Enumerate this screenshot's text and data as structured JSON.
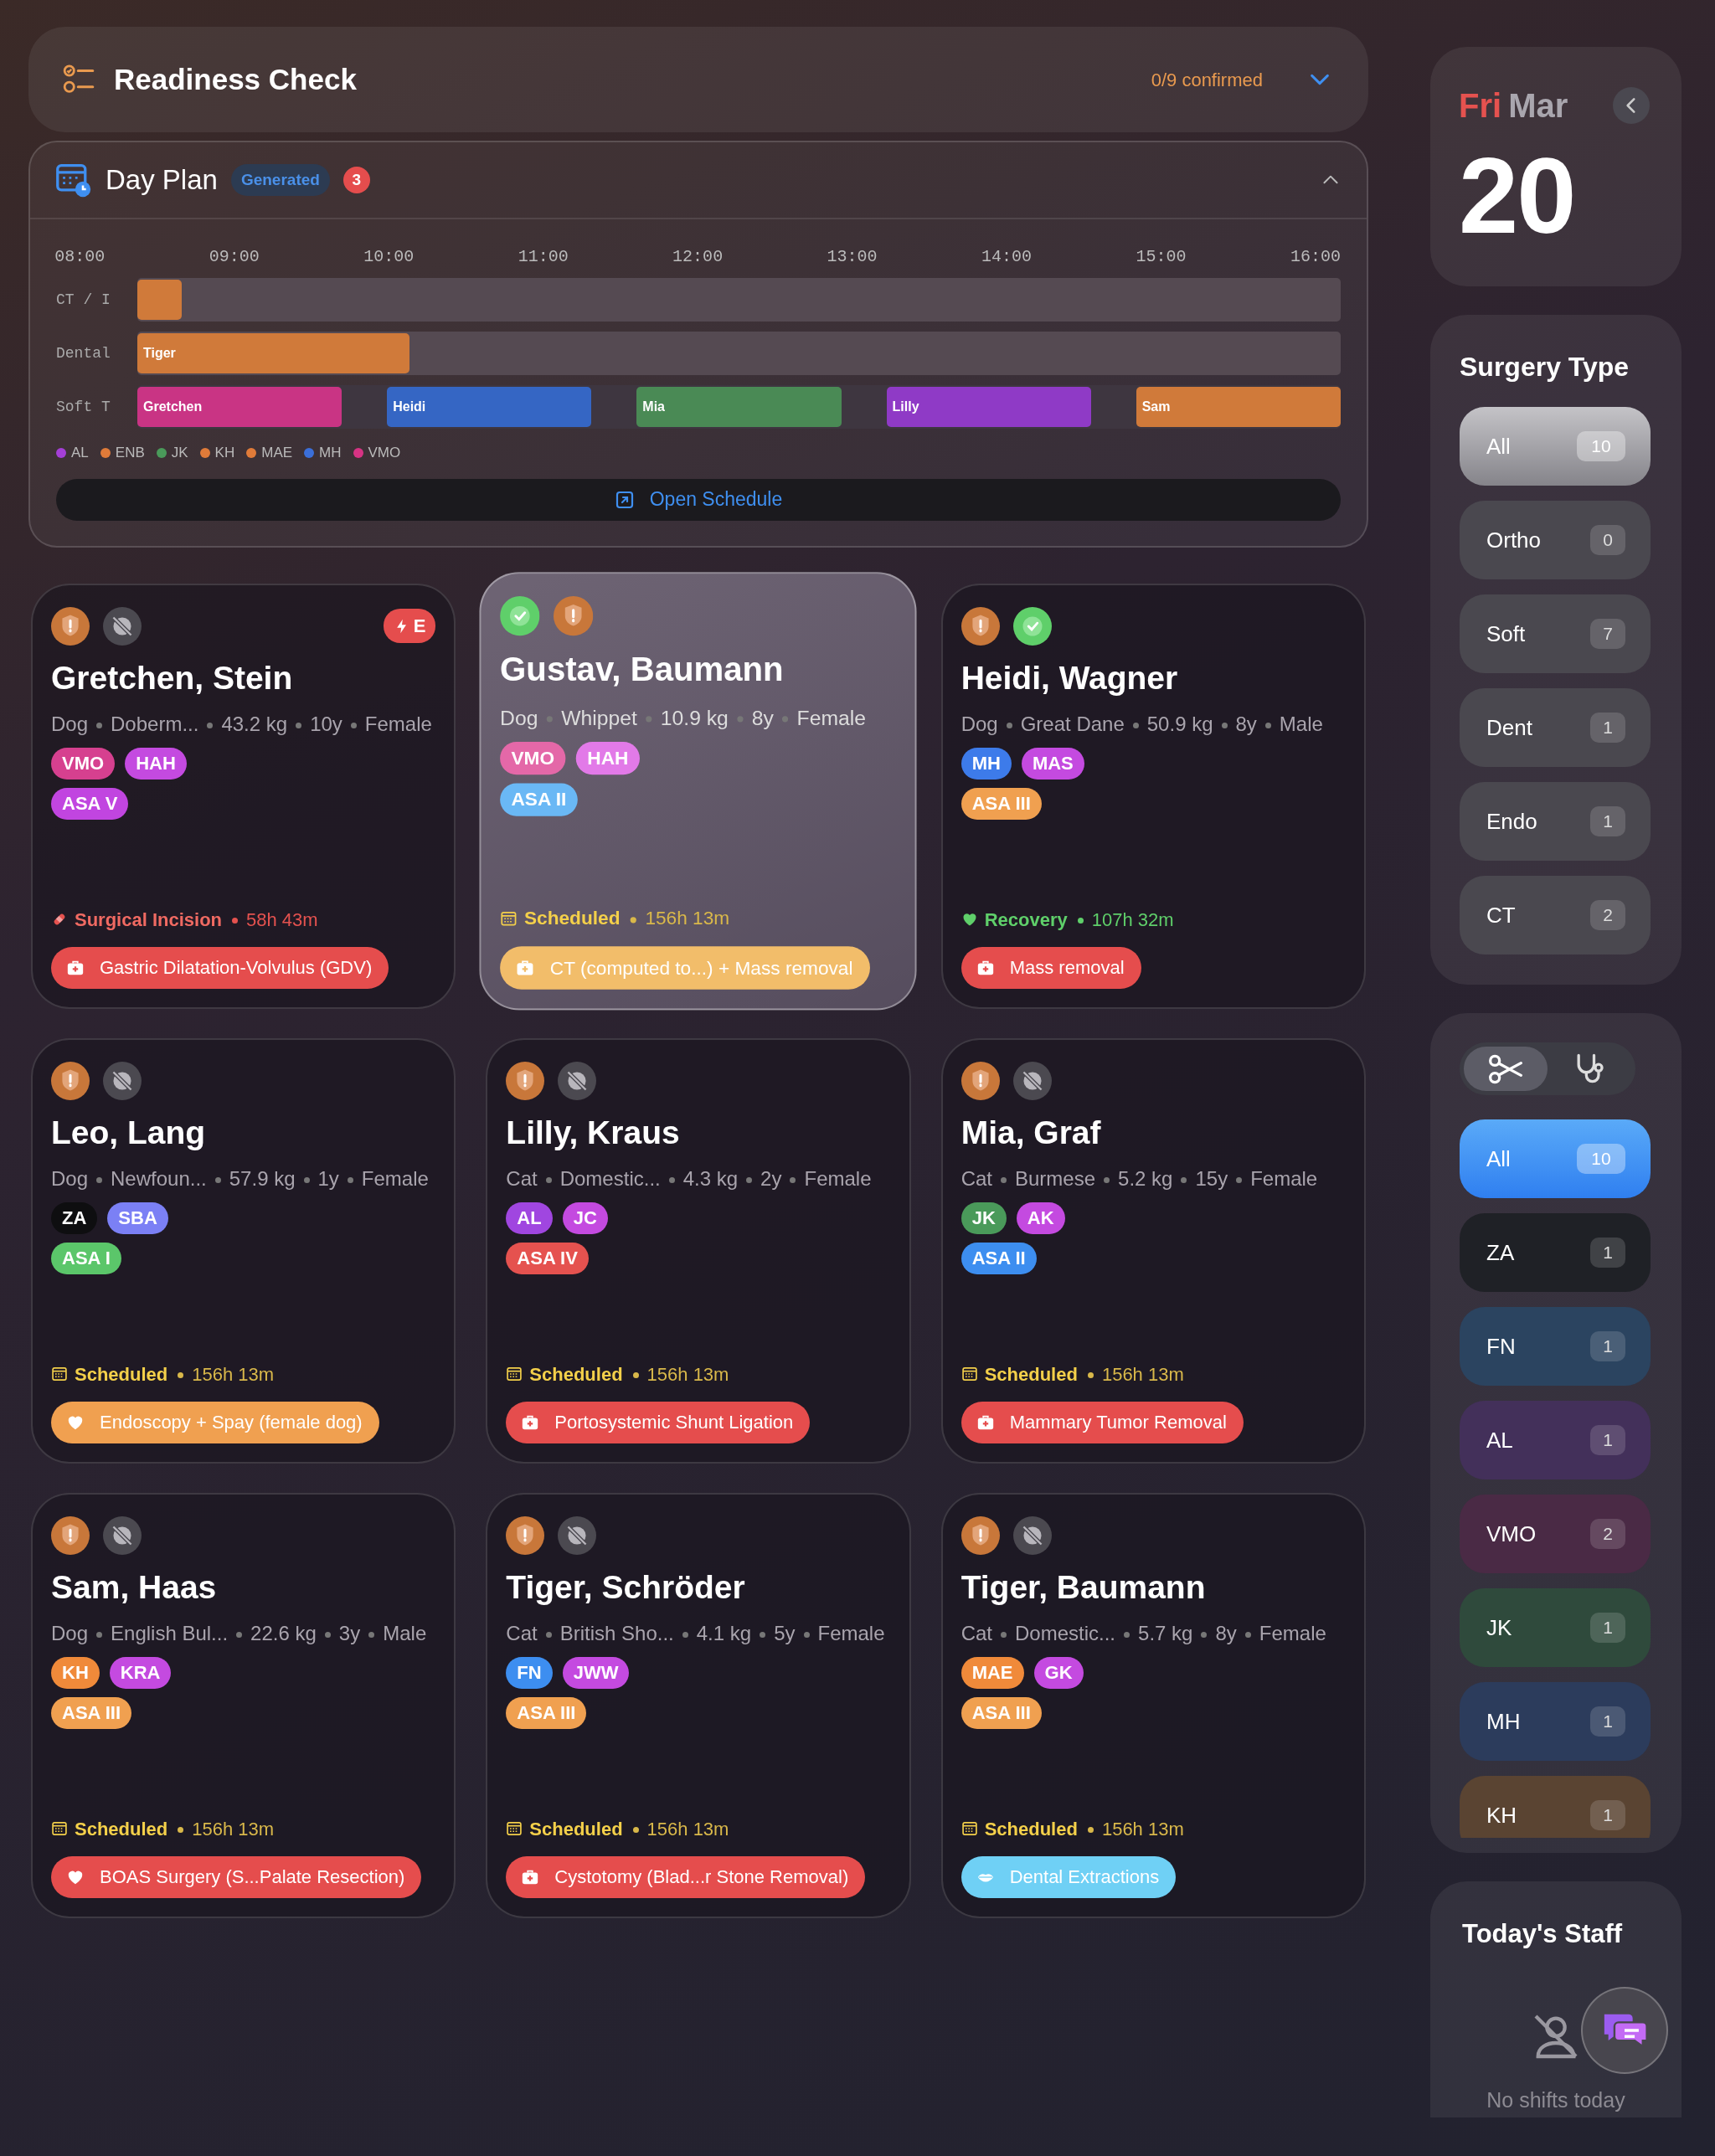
{
  "readiness": {
    "title": "Readiness Check",
    "summary": "0/9 confirmed",
    "expanded": false
  },
  "day_plan": {
    "title": "Day Plan",
    "badge": "Generated",
    "count": "3",
    "expanded": true,
    "ticks": [
      "08:00",
      "09:00",
      "10:00",
      "11:00",
      "12:00",
      "13:00",
      "14:00",
      "15:00",
      "16:00"
    ],
    "lanes": [
      {
        "label": "CT / I",
        "bars": [
          {
            "level": 0.037,
            "color": "#d07a3a"
          }
        ]
      },
      {
        "label": "Dental",
        "bars": [
          {
            "label": "Tiger",
            "level": 0.226,
            "color": "#d07a3a"
          }
        ]
      },
      {
        "label": "Soft T",
        "bars": [
          {
            "label": "Gretchen",
            "color": "#c93484"
          },
          {
            "label": "Heidi",
            "color": "#3566c4"
          },
          {
            "label": "Mia",
            "color": "#4a8a55"
          },
          {
            "label": "Lilly",
            "color": "#8f3ac6"
          },
          {
            "label": "Sam",
            "color": "#d07a3a"
          }
        ]
      }
    ],
    "legend": [
      {
        "label": "AL",
        "color": "#a43fd6"
      },
      {
        "label": "ENB",
        "color": "#e07b39"
      },
      {
        "label": "JK",
        "color": "#4a9a5a"
      },
      {
        "label": "KH",
        "color": "#e07b39"
      },
      {
        "label": "MAE",
        "color": "#e07b39"
      },
      {
        "label": "MH",
        "color": "#3b6fd9"
      },
      {
        "label": "VMO",
        "color": "#d63384"
      }
    ],
    "action": "Open Schedule"
  },
  "patients": [
    {
      "name": "Gretchen, Stein",
      "selected": false,
      "flags": [
        {
          "kind": "alert"
        },
        {
          "kind": "blocked"
        }
      ],
      "emergency": "E",
      "details": [
        "Dog",
        "Doberm...",
        "43.2 kg",
        "10y",
        "Female"
      ],
      "staff": [
        {
          "label": "VMO",
          "color": "#d6408f"
        },
        {
          "label": "HAH",
          "color": "#c44ae0"
        }
      ],
      "asa": {
        "label": "ASA V",
        "color": "#c145e0"
      },
      "status": {
        "kind": "incision",
        "label": "Surgical Incision",
        "time": "58h 43m"
      },
      "procedure": {
        "kind": "medkit",
        "label": "Gastric Dilatation-Volvulus (GDV)",
        "color": "#e54d4d"
      }
    },
    {
      "name": "Gustav, Baumann",
      "selected": true,
      "flags": [
        {
          "kind": "check"
        },
        {
          "kind": "alert"
        }
      ],
      "details": [
        "Dog",
        "Whippet",
        "10.9 kg",
        "8y",
        "Female"
      ],
      "staff": [
        {
          "label": "VMO",
          "color": "#e468a8"
        },
        {
          "label": "HAH",
          "color": "#e27ae8"
        }
      ],
      "asa": {
        "label": "ASA II",
        "color": "#6ab8f5"
      },
      "status": {
        "kind": "scheduled",
        "label": "Scheduled",
        "time": "156h 13m"
      },
      "procedure": {
        "kind": "medkit",
        "label": "CT (computed to...) + Mass removal",
        "color": "#f2bd6a"
      }
    },
    {
      "name": "Heidi, Wagner",
      "selected": false,
      "flags": [
        {
          "kind": "alert"
        },
        {
          "kind": "check"
        }
      ],
      "details": [
        "Dog",
        "Great Dane",
        "50.9 kg",
        "8y",
        "Male"
      ],
      "staff": [
        {
          "label": "MH",
          "color": "#3d7bea"
        },
        {
          "label": "MAS",
          "color": "#c44ae0"
        }
      ],
      "asa": {
        "label": "ASA III",
        "color": "#f0a050"
      },
      "status": {
        "kind": "recovery",
        "label": "Recovery",
        "time": "107h 32m"
      },
      "procedure": {
        "kind": "medkit",
        "label": "Mass removal",
        "color": "#e54d4d"
      }
    },
    {
      "name": "Leo, Lang",
      "selected": false,
      "flags": [
        {
          "kind": "alert"
        },
        {
          "kind": "blocked"
        }
      ],
      "details": [
        "Dog",
        "Newfoun...",
        "57.9 kg",
        "1y",
        "Female"
      ],
      "staff": [
        {
          "label": "ZA",
          "color": "#0e0e10"
        },
        {
          "label": "SBA",
          "color": "#7b80f5"
        }
      ],
      "asa": {
        "label": "ASA I",
        "color": "#5bc66a"
      },
      "status": {
        "kind": "scheduled",
        "label": "Scheduled",
        "time": "156h 13m"
      },
      "procedure": {
        "kind": "heart",
        "label": "Endoscopy + Spay (female dog)",
        "color": "#f0a050"
      }
    },
    {
      "name": "Lilly, Kraus",
      "selected": false,
      "flags": [
        {
          "kind": "alert"
        },
        {
          "kind": "blocked"
        }
      ],
      "details": [
        "Cat",
        "Domestic...",
        "4.3 kg",
        "2y",
        "Female"
      ],
      "staff": [
        {
          "label": "AL",
          "color": "#a046e0"
        },
        {
          "label": "JC",
          "color": "#c44ae0"
        }
      ],
      "asa": {
        "label": "ASA IV",
        "color": "#e5524f"
      },
      "status": {
        "kind": "scheduled",
        "label": "Scheduled",
        "time": "156h 13m"
      },
      "procedure": {
        "kind": "medkit",
        "label": "Portosystemic Shunt Ligation",
        "color": "#e54d4d"
      }
    },
    {
      "name": "Mia, Graf",
      "selected": false,
      "flags": [
        {
          "kind": "alert"
        },
        {
          "kind": "blocked"
        }
      ],
      "details": [
        "Cat",
        "Burmese",
        "5.2 kg",
        "15y",
        "Female"
      ],
      "staff": [
        {
          "label": "JK",
          "color": "#4a9a5a"
        },
        {
          "label": "AK",
          "color": "#c44ae0"
        }
      ],
      "asa": {
        "label": "ASA II",
        "color": "#3d8ef0"
      },
      "status": {
        "kind": "scheduled",
        "label": "Scheduled",
        "time": "156h 13m"
      },
      "procedure": {
        "kind": "medkit",
        "label": "Mammary Tumor Removal",
        "color": "#e54d4d"
      }
    },
    {
      "name": "Sam, Haas",
      "selected": false,
      "flags": [
        {
          "kind": "alert"
        },
        {
          "kind": "blocked"
        }
      ],
      "details": [
        "Dog",
        "English Bul...",
        "22.6 kg",
        "3y",
        "Male"
      ],
      "staff": [
        {
          "label": "KH",
          "color": "#f08a3a"
        },
        {
          "label": "KRA",
          "color": "#c44ae0"
        }
      ],
      "asa": {
        "label": "ASA III",
        "color": "#f0a050"
      },
      "status": {
        "kind": "scheduled",
        "label": "Scheduled",
        "time": "156h 13m"
      },
      "procedure": {
        "kind": "heart",
        "label": "BOAS Surgery (S...Palate Resection)",
        "color": "#e54d4d"
      }
    },
    {
      "name": "Tiger, Schröder",
      "selected": false,
      "flags": [
        {
          "kind": "alert"
        },
        {
          "kind": "blocked"
        }
      ],
      "details": [
        "Cat",
        "British Sho...",
        "4.1 kg",
        "5y",
        "Female"
      ],
      "staff": [
        {
          "label": "FN",
          "color": "#3d8ef0"
        },
        {
          "label": "JWW",
          "color": "#c44ae0"
        }
      ],
      "asa": {
        "label": "ASA III",
        "color": "#f0a050"
      },
      "status": {
        "kind": "scheduled",
        "label": "Scheduled",
        "time": "156h 13m"
      },
      "procedure": {
        "kind": "medkit",
        "label": "Cystotomy (Blad...r Stone Removal)",
        "color": "#e54d4d"
      }
    },
    {
      "name": "Tiger, Baumann",
      "selected": false,
      "flags": [
        {
          "kind": "alert"
        },
        {
          "kind": "blocked"
        }
      ],
      "details": [
        "Cat",
        "Domestic...",
        "5.7 kg",
        "8y",
        "Female"
      ],
      "staff": [
        {
          "label": "MAE",
          "color": "#f08a3a"
        },
        {
          "label": "GK",
          "color": "#c44ae0"
        }
      ],
      "asa": {
        "label": "ASA III",
        "color": "#f0a050"
      },
      "status": {
        "kind": "scheduled",
        "label": "Scheduled",
        "time": "156h 13m"
      },
      "procedure": {
        "kind": "lips",
        "label": "Dental Extractions",
        "color": "#6fd0f5"
      }
    }
  ],
  "date": {
    "weekday": "Fri",
    "month": "Mar",
    "day": "20"
  },
  "surgery_types": {
    "title": "Surgery Type",
    "items": [
      {
        "label": "All",
        "count": "10",
        "selected": true
      },
      {
        "label": "Ortho",
        "count": "0",
        "selected": false
      },
      {
        "label": "Soft",
        "count": "7",
        "selected": false
      },
      {
        "label": "Dent",
        "count": "1",
        "selected": false
      },
      {
        "label": "Endo",
        "count": "1",
        "selected": false
      },
      {
        "label": "CT",
        "count": "2",
        "selected": false
      }
    ]
  },
  "staff_filter": {
    "modes": [
      {
        "kind": "scissors",
        "selected": true
      },
      {
        "kind": "stethoscope",
        "selected": false
      }
    ],
    "items": [
      {
        "label": "All",
        "count": "10",
        "color": "#3b8ff5",
        "selected": true
      },
      {
        "label": "ZA",
        "count": "1",
        "color": "#1f2126",
        "selected": false
      },
      {
        "label": "FN",
        "count": "1",
        "color": "#2b4460",
        "selected": false
      },
      {
        "label": "AL",
        "count": "1",
        "color": "#43305a",
        "selected": false
      },
      {
        "label": "VMO",
        "count": "2",
        "color": "#4a2a45",
        "selected": false
      },
      {
        "label": "JK",
        "count": "1",
        "color": "#2f4a3c",
        "selected": false
      },
      {
        "label": "MH",
        "count": "1",
        "color": "#2c3c5c",
        "selected": false
      },
      {
        "label": "KH",
        "count": "1",
        "color": "#5a4432",
        "selected": false
      }
    ]
  },
  "todays_staff": {
    "title": "Today's Staff",
    "empty_text": "No shifts today"
  }
}
